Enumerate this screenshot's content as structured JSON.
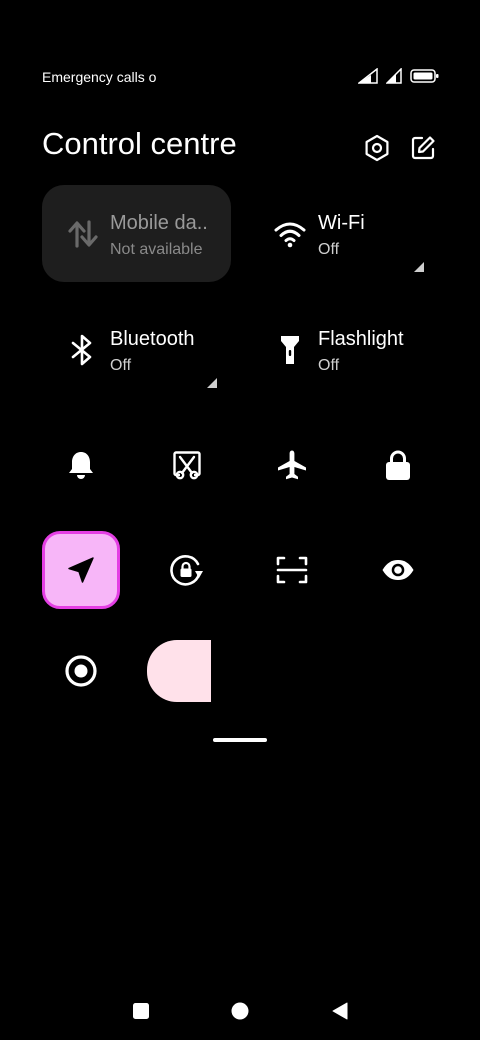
{
  "status_bar": {
    "carrier_text": "Emergency calls o",
    "icons": [
      "signal-1-icon",
      "signal-2-icon",
      "battery-icon"
    ]
  },
  "header": {
    "title": "Control centre",
    "settings_icon": "settings-hexagon-icon",
    "edit_icon": "edit-icon"
  },
  "tiles": [
    {
      "name": "Mobile da..",
      "status": "Not available",
      "icon": "mobile-data-icon",
      "state": "disabled"
    },
    {
      "name": "Wi-Fi",
      "status": "Off",
      "icon": "wifi-icon",
      "state": "off"
    },
    {
      "name": "Bluetooth",
      "status": "Off",
      "icon": "bluetooth-icon",
      "state": "off"
    },
    {
      "name": "Flashlight",
      "status": "Off",
      "icon": "flashlight-icon",
      "state": "off"
    }
  ],
  "toggles_row1": [
    "bell-icon",
    "screenshot-scissors-icon",
    "airplane-icon",
    "lock-icon"
  ],
  "toggles_row2": [
    "location-arrow-icon",
    "rotation-lock-icon",
    "scan-icon",
    "reading-mode-eye-icon"
  ],
  "toggles_row3": [
    "focus-circle-icon"
  ],
  "colors": {
    "active_toggle_bg": "#f7b6f8",
    "active_toggle_border": "#e43fe4",
    "pill": "#ffe1ea",
    "tile_bg": "#1e1e1e"
  },
  "nav_bar": [
    "recents-square-icon",
    "home-circle-icon",
    "back-triangle-icon"
  ]
}
